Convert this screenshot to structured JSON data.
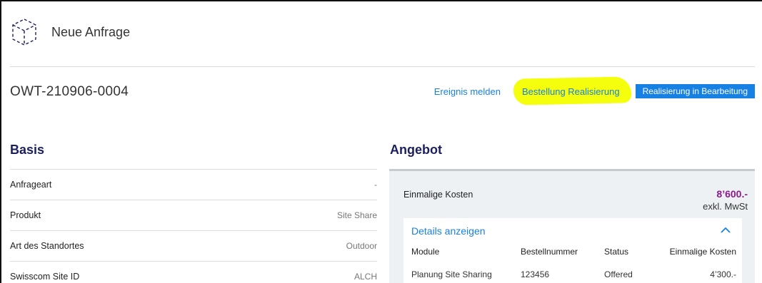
{
  "header": {
    "title": "Neue Anfrage",
    "icon": "cube-icon"
  },
  "request": {
    "id": "OWT-210906-0004"
  },
  "actions": {
    "event_link": "Ereignis melden",
    "order_link": "Bestellung Realisierung",
    "status_button": "Realisierung in Bearbeitung"
  },
  "basis": {
    "title": "Basis",
    "rows": [
      {
        "label": "Anfrageart",
        "value": "-"
      },
      {
        "label": "Produkt",
        "value": "Site Share"
      },
      {
        "label": "Art des Standortes",
        "value": "Outdoor"
      },
      {
        "label": "Swisscom Site ID",
        "value": "ALCH"
      }
    ]
  },
  "angebot": {
    "title": "Angebot",
    "cost_label": "Einmalige Kosten",
    "cost_amount": "8’600.-",
    "cost_note": "exkl. MwSt",
    "details_link": "Details anzeigen",
    "table": {
      "headers": [
        "Module",
        "Bestellnummer",
        "Status",
        "Einmalige Kosten"
      ],
      "rows": [
        [
          "Planung Site Sharing",
          "123456",
          "Offered",
          "4’300.-"
        ]
      ]
    }
  },
  "colors": {
    "accent": "#1781e3",
    "highlight": "#f4ff00",
    "price": "#8a1c8c",
    "heading": "#1b1f5e"
  }
}
